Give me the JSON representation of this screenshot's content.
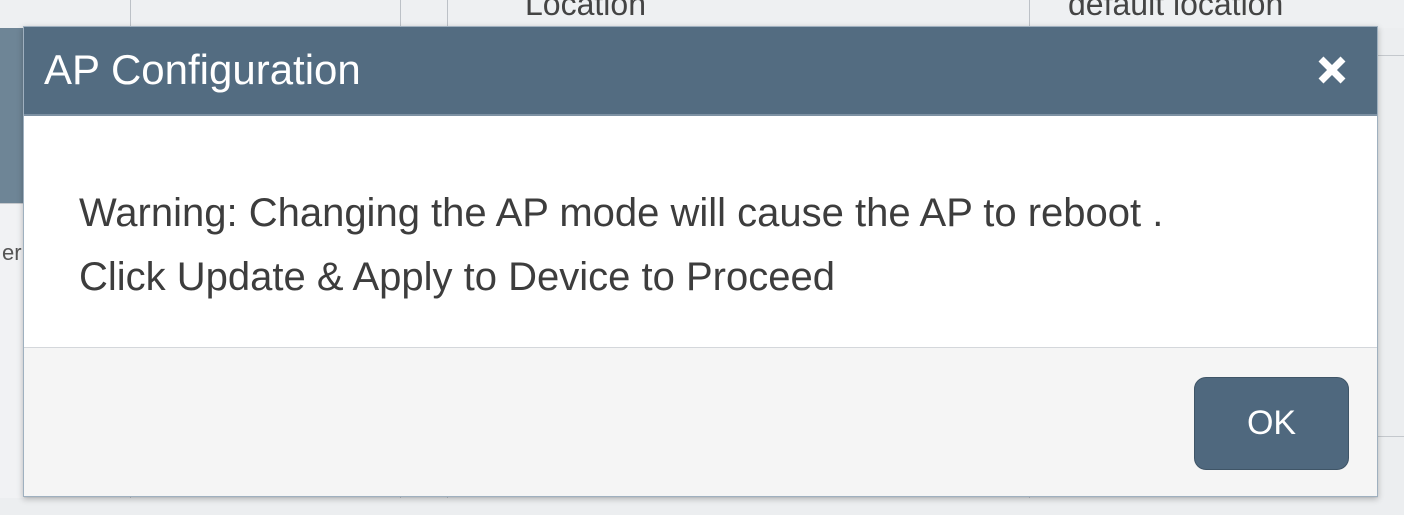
{
  "background": {
    "top_labels": [
      "Location",
      "default location"
    ],
    "left_fragment": "er"
  },
  "dialog": {
    "title": "AP Configuration",
    "close_icon": "close-icon",
    "message": "Warning: Changing the AP mode will cause the AP to reboot . Click Update & Apply to Device to Proceed",
    "ok_label": "OK"
  },
  "colors": {
    "header_bg": "#536c81",
    "button_bg": "#4f687e",
    "footer_bg": "#f5f5f5",
    "text": "#3d3d3d"
  }
}
